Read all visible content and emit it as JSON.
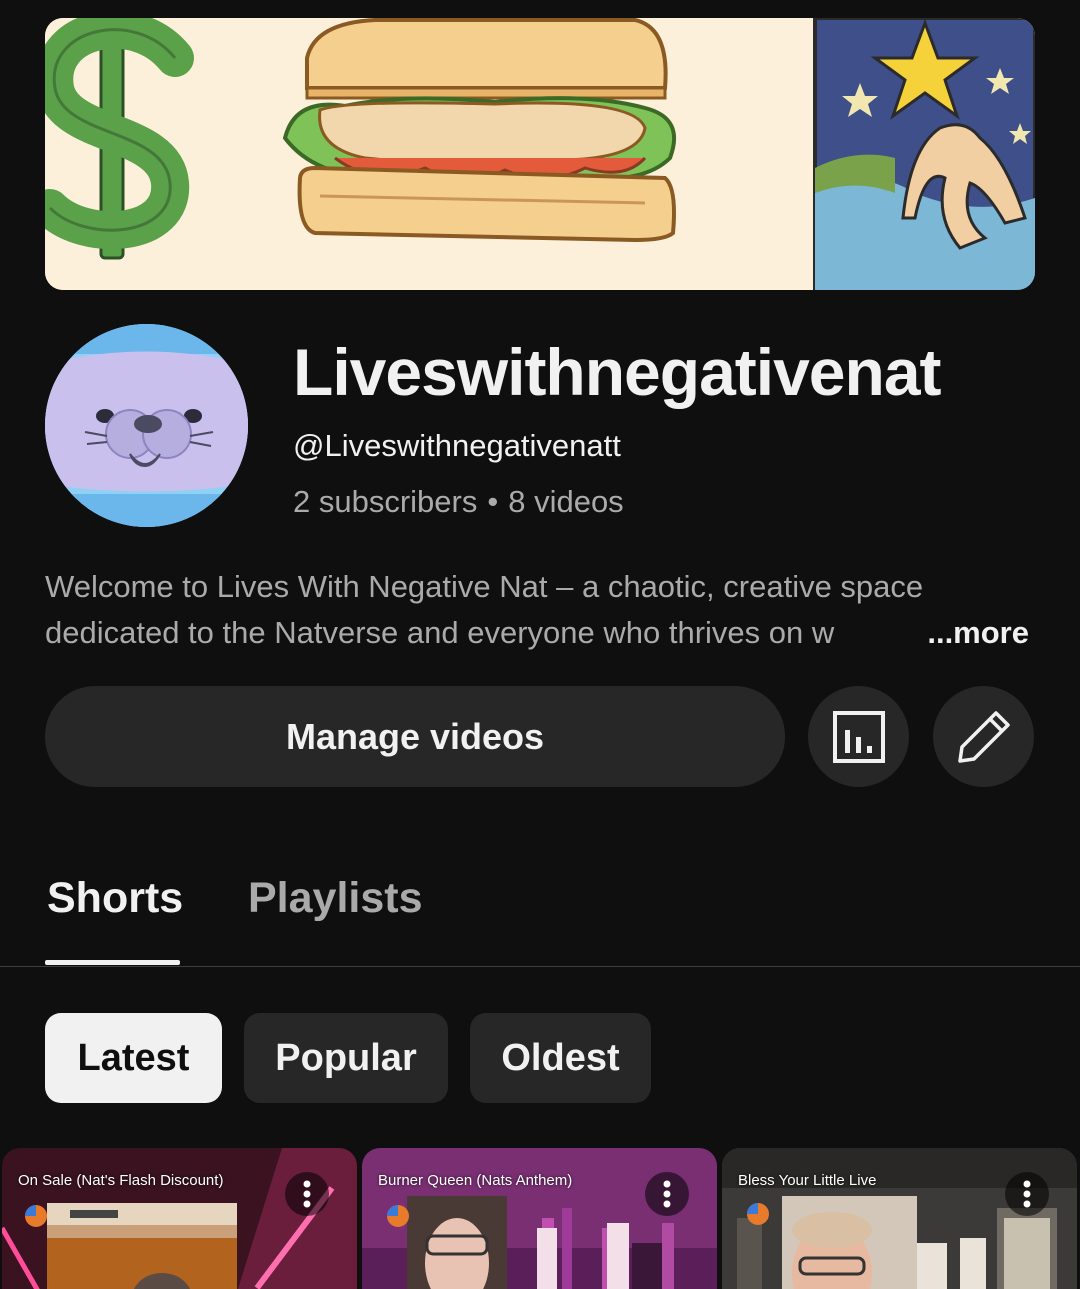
{
  "channel": {
    "name": "Liveswithnegativenat",
    "handle": "@Liveswithnegativenatt",
    "subscribers": "2 subscribers",
    "separator": "•",
    "videos": "8 videos",
    "description_line1": "Welcome to Lives With Negative Nat – a chaotic, creative space",
    "description_line2": "dedicated to the Natverse and everyone who thrives on w",
    "more_label": "...more"
  },
  "actions": {
    "manage_videos_label": "Manage videos",
    "analytics_icon": "analytics-icon",
    "edit_icon": "pencil-icon"
  },
  "tabs": [
    {
      "label": "Shorts",
      "active": true
    },
    {
      "label": "Playlists",
      "active": false
    }
  ],
  "chips": [
    {
      "label": "Latest",
      "selected": true
    },
    {
      "label": "Popular",
      "selected": false
    },
    {
      "label": "Oldest",
      "selected": false
    }
  ],
  "shorts": [
    {
      "title": "On Sale (Nat's Flash Discount)"
    },
    {
      "title": "Burner Queen (Nats Anthem)"
    },
    {
      "title": "Bless Your Little Live"
    }
  ],
  "colors": {
    "background": "#0f0f0f",
    "button_bg": "#272727",
    "text_primary": "#f1f1f1",
    "text_secondary": "#aaaaaa",
    "chip_selected_bg": "#f1f1f1"
  }
}
